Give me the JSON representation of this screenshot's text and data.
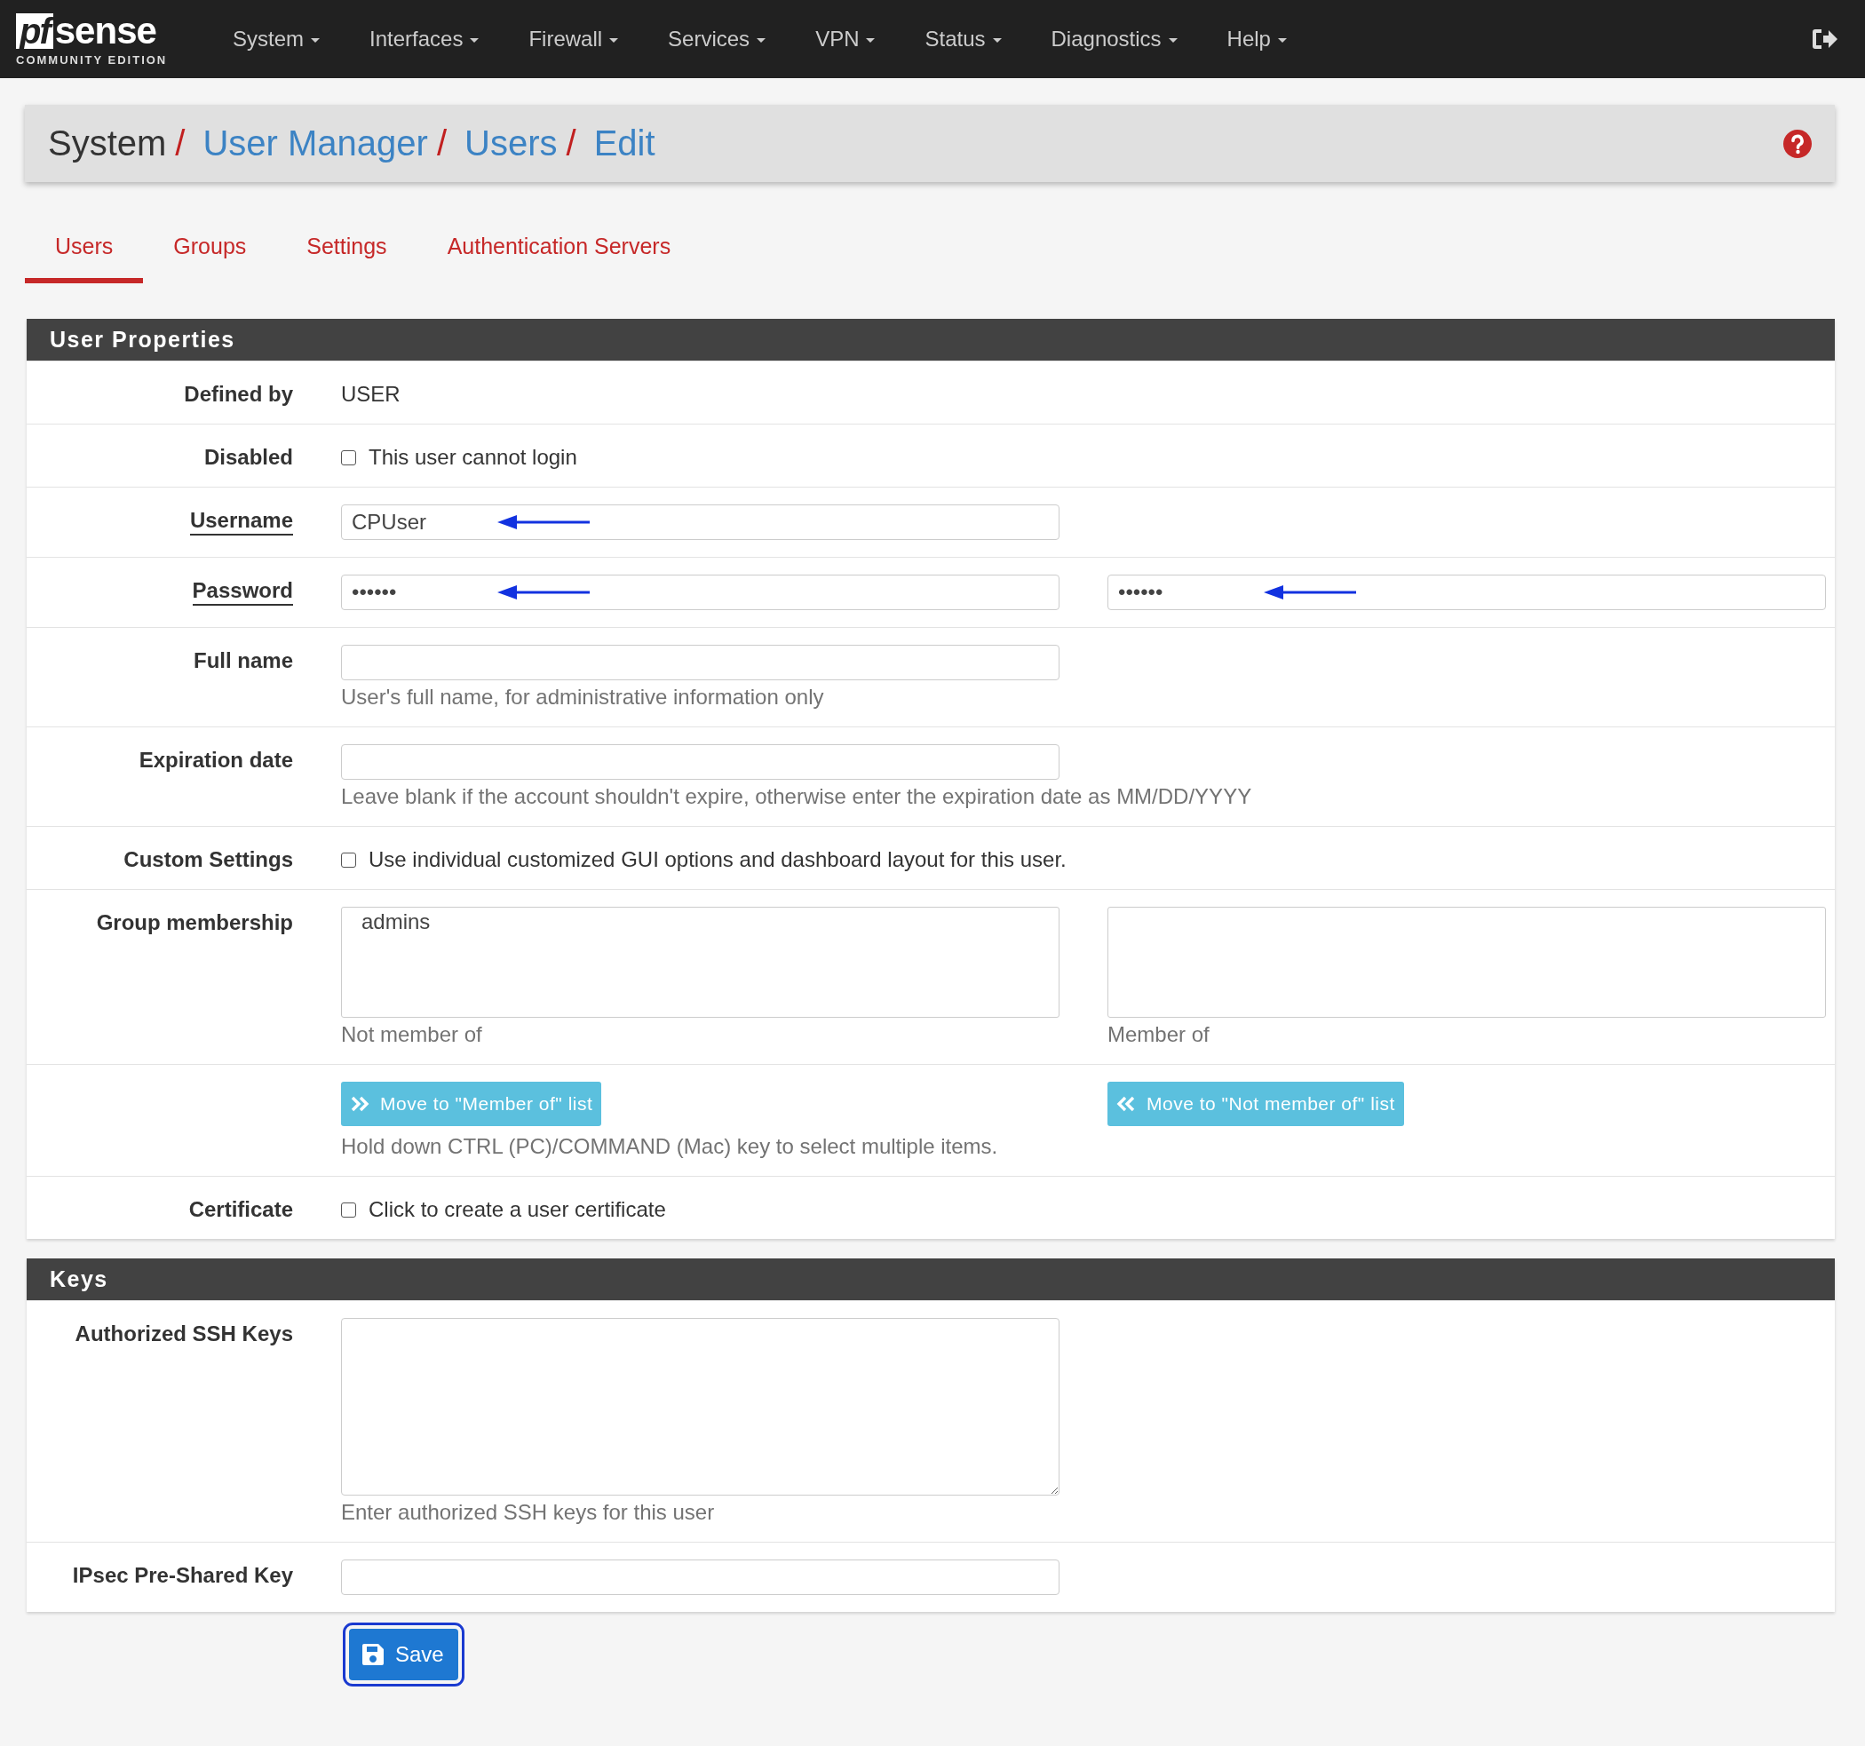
{
  "navbar": {
    "logo": {
      "mark": "pf",
      "name": "sense",
      "edition": "COMMUNITY EDITION"
    },
    "menus": [
      {
        "label": "System"
      },
      {
        "label": "Interfaces"
      },
      {
        "label": "Firewall"
      },
      {
        "label": "Services"
      },
      {
        "label": "VPN"
      },
      {
        "label": "Status"
      },
      {
        "label": "Diagnostics"
      },
      {
        "label": "Help"
      }
    ]
  },
  "breadcrumb": {
    "separator": "/",
    "items": [
      {
        "label": "System",
        "link": false
      },
      {
        "label": "User Manager",
        "link": true
      },
      {
        "label": "Users",
        "link": true
      },
      {
        "label": "Edit",
        "link": true
      }
    ]
  },
  "tabs": [
    {
      "label": "Users",
      "selected": true
    },
    {
      "label": "Groups",
      "selected": false
    },
    {
      "label": "Settings",
      "selected": false
    },
    {
      "label": "Authentication Servers",
      "selected": false
    }
  ],
  "sections": [
    {
      "title": "User Properties",
      "rows": [
        {
          "kind": "text",
          "label": "Defined by",
          "required": false,
          "value": "USER"
        },
        {
          "kind": "checkbox",
          "label": "Disabled",
          "required": false,
          "checked": false,
          "text": "This user cannot login"
        },
        {
          "kind": "input",
          "label": "Username",
          "required": true,
          "fields": [
            {
              "value": "CPUser",
              "arrow": true
            }
          ]
        },
        {
          "kind": "input",
          "label": "Password",
          "required": true,
          "fields": [
            {
              "value": "••••••",
              "arrow": true
            },
            {
              "value": "••••••",
              "arrow": true
            }
          ]
        },
        {
          "kind": "input",
          "label": "Full name",
          "required": false,
          "fields": [
            {
              "arrow": false
            }
          ],
          "help": "User's full name, for administrative information only"
        },
        {
          "kind": "input",
          "label": "Expiration date",
          "required": false,
          "fields": [
            {
              "arrow": false
            }
          ],
          "help": "Leave blank if the account shouldn't expire, otherwise enter the expiration date as MM/DD/YYYY"
        },
        {
          "kind": "checkbox",
          "label": "Custom Settings",
          "required": false,
          "checked": false,
          "text": "Use individual customized GUI options and dashboard layout for this user."
        },
        {
          "kind": "multiselect",
          "label": "Group membership",
          "required": false,
          "lists": [
            {
              "options": [
                "admins"
              ],
              "caption": "Not member of"
            },
            {
              "caption": "Member of"
            }
          ]
        },
        {
          "kind": "buttons",
          "buttons": [
            {
              "label": "Move to \"Member of\" list",
              "kind": "add"
            },
            {
              "label": "Move to \"Not member of\" list",
              "kind": "remove"
            }
          ],
          "help": "Hold down CTRL (PC)/COMMAND (Mac) key to select multiple items."
        },
        {
          "kind": "checkbox",
          "label": "Certificate",
          "required": false,
          "checked": false,
          "text": "Click to create a user certificate"
        }
      ]
    },
    {
      "title": "Keys",
      "rows": [
        {
          "kind": "textarea",
          "label": "Authorized SSH Keys",
          "required": false,
          "help": "Enter authorized SSH keys for this user"
        },
        {
          "kind": "input",
          "label": "IPsec Pre-Shared Key",
          "required": false,
          "fields": [
            {
              "arrow": false
            }
          ]
        }
      ]
    }
  ],
  "save_button": {
    "label": "Save"
  }
}
